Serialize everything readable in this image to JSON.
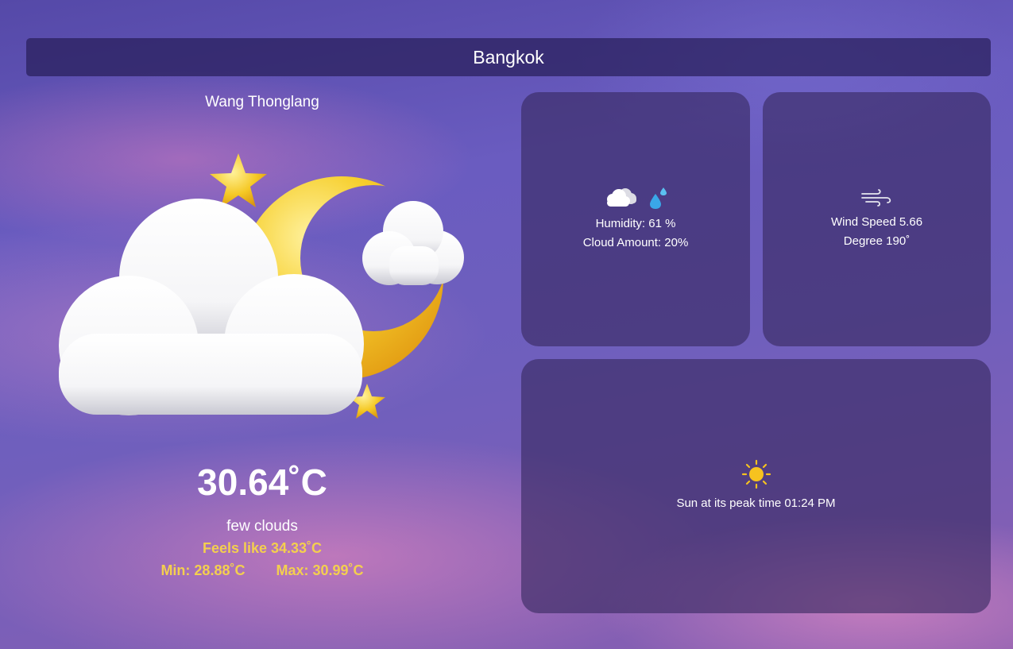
{
  "header": {
    "city": "Bangkok"
  },
  "location": {
    "district": "Wang Thonglang"
  },
  "current": {
    "temperature": "30.64˚C",
    "description": "few clouds",
    "feels_like": "Feels like 34.33˚C",
    "min": "Min: 28.88˚C",
    "max": "Max: 30.99˚C",
    "icon": "cloud-moon-stars-icon"
  },
  "humidity_card": {
    "humidity": "Humidity: 61 %",
    "cloud_amount": "Cloud Amount: 20%",
    "icons": [
      "cloud-icon",
      "droplet-icon"
    ]
  },
  "wind_card": {
    "speed": "Wind Speed 5.66",
    "degree": "Degree 190˚",
    "icon": "wind-icon"
  },
  "sun_card": {
    "peak": "Sun at its peak time 01:24 PM",
    "icon": "sun-icon"
  },
  "colors": {
    "accent": "#f4cf4e",
    "header_bg": "#2b2262"
  }
}
